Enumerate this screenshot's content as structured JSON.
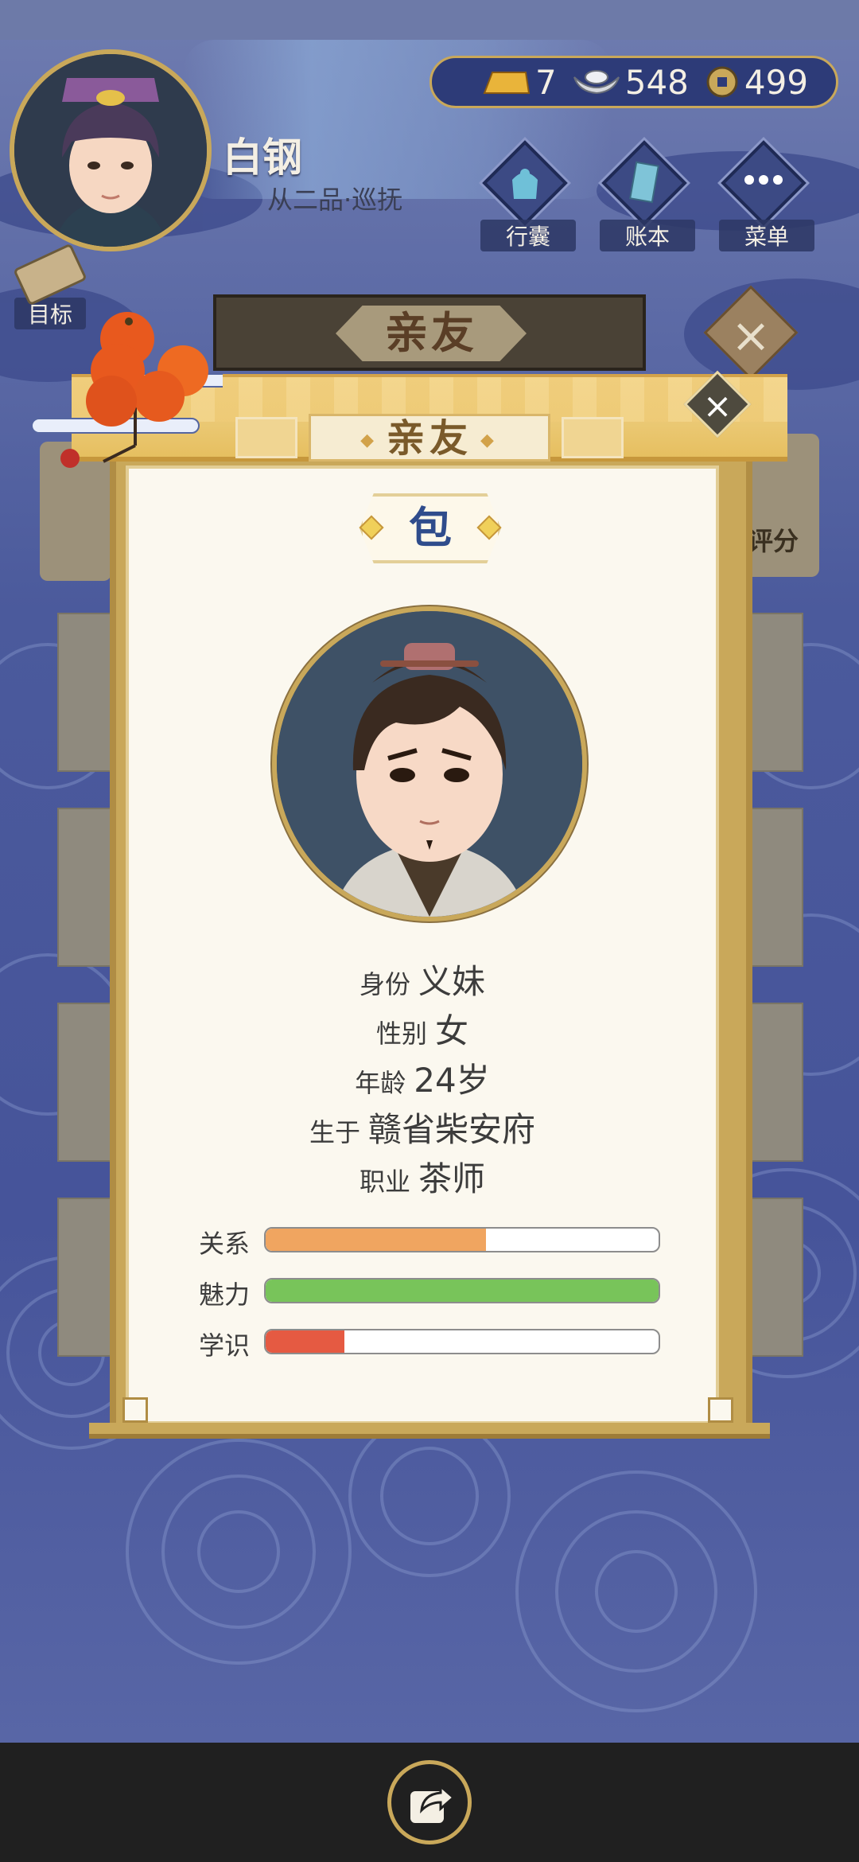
{
  "player": {
    "name": "白钢",
    "rank": "从二品·巡抚"
  },
  "currency": {
    "gold": "7",
    "silver": "548",
    "coin": "499"
  },
  "menu": {
    "bag": "行囊",
    "ledger": "账本",
    "menu": "菜单",
    "goal": "目标"
  },
  "background_panel": {
    "title": "亲友",
    "side_label": "评分"
  },
  "modal": {
    "title": "亲友",
    "surname": "包",
    "info": [
      {
        "key": "身份",
        "value": "义妹"
      },
      {
        "key": "性别",
        "value": "女"
      },
      {
        "key": "年龄",
        "value": "24岁"
      },
      {
        "key": "生于",
        "value": "赣省柴安府"
      },
      {
        "key": "职业",
        "value": "茶师"
      }
    ],
    "stats": [
      {
        "label": "关系",
        "fraction": 0.56,
        "color": "#f0a560"
      },
      {
        "label": "魅力",
        "fraction": 1.0,
        "color": "#78c45a"
      },
      {
        "label": "学识",
        "fraction": 0.2,
        "color": "#e55a42"
      }
    ]
  },
  "colors": {
    "accent_gold": "#c9a85a",
    "title_brown": "#7a5a2a",
    "surname_blue": "#2f4c8c"
  }
}
